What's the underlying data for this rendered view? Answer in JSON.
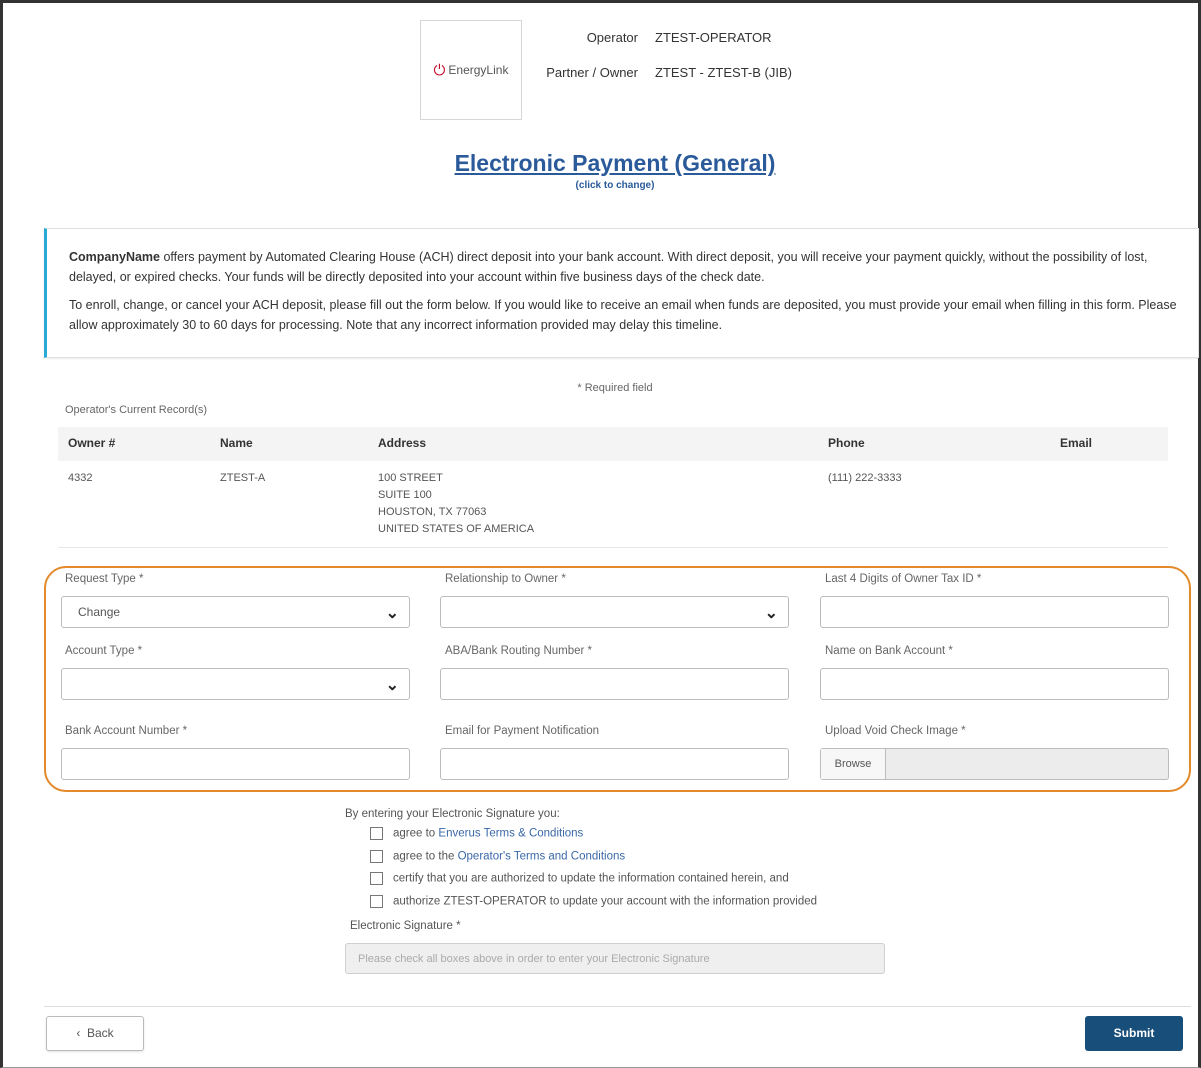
{
  "header": {
    "logo_text_a": "EnergyLink",
    "operator_label": "Operator",
    "operator_value": "ZTEST-OPERATOR",
    "partner_label": "Partner / Owner",
    "partner_value": "ZTEST - ZTEST-B (JIB)",
    "title": "Electronic Payment (General)",
    "title_sub": "(click to change)"
  },
  "info": {
    "company": "CompanyName",
    "para1_rest": " offers payment by Automated Clearing House (ACH) direct deposit into your bank account. With direct deposit, you will receive your payment quickly, without the possibility of lost, delayed, or expired checks. Your funds will be directly deposited into your account within five business days of the check date.",
    "para2": "To enroll, change, or cancel your ACH deposit, please fill out the form below. If you would like to receive an email when funds are deposited, you must provide your email when filling in this form. Please allow approximately 30 to 60 days for processing. Note that any incorrect information provided may delay this timeline."
  },
  "required_note": "* Required field",
  "records": {
    "title": "Operator's Current Record(s)",
    "headers": [
      "Owner #",
      "Name",
      "Address",
      "Phone",
      "Email"
    ],
    "row": {
      "owner": "4332",
      "name": "ZTEST-A",
      "address": [
        "100 STREET",
        "SUITE 100",
        "HOUSTON, TX  77063",
        "UNITED STATES OF AMERICA"
      ],
      "phone": "(111) 222-3333",
      "email": ""
    }
  },
  "form": {
    "request_type_label": "Request Type *",
    "request_type_value": "Change",
    "relationship_label": "Relationship to Owner *",
    "relationship_value": "",
    "tax_id_label": "Last 4 Digits of Owner Tax ID *",
    "account_type_label": "Account Type *",
    "account_type_value": "",
    "routing_label": "ABA/Bank Routing Number *",
    "name_on_account_label": "Name on Bank Account *",
    "account_number_label": "Bank Account Number *",
    "email_label": "Email for Payment Notification",
    "upload_label": "Upload Void Check Image *",
    "browse_label": "Browse"
  },
  "signature": {
    "intro": "By entering your Electronic Signature you:",
    "items": [
      {
        "prefix": "agree to ",
        "link": "Enverus Terms & Conditions",
        "suffix": ""
      },
      {
        "prefix": "agree to the ",
        "link": "Operator's Terms and Conditions",
        "suffix": ""
      },
      {
        "prefix": "certify that you are authorized to update the information contained herein, and",
        "link": "",
        "suffix": ""
      },
      {
        "prefix": "authorize ZTEST-OPERATOR to update your account with the information provided",
        "link": "",
        "suffix": ""
      }
    ],
    "label": "Electronic Signature *",
    "placeholder": "Please check all boxes above in order to enter your Electronic Signature"
  },
  "buttons": {
    "back": "Back",
    "submit": "Submit"
  },
  "colors": {
    "accent": "#2a5a9a",
    "info_bar": "#29a9d6",
    "form_outline": "#e38a2a",
    "submit_bg": "#184e7a"
  }
}
